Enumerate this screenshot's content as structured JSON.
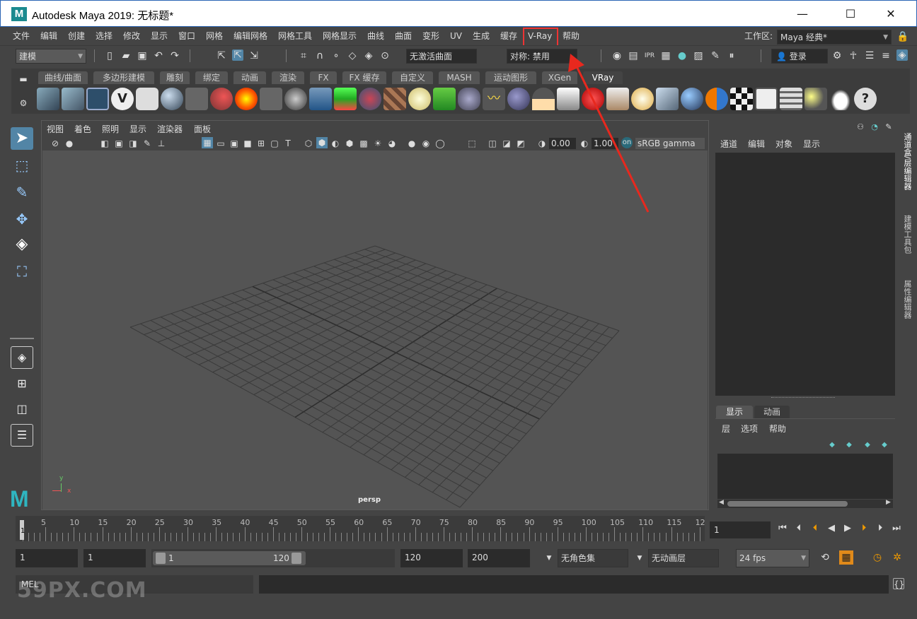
{
  "window": {
    "title": "Autodesk Maya 2019: 无标题*",
    "logo_letter": "M"
  },
  "menu": {
    "items": [
      "文件",
      "编辑",
      "创建",
      "选择",
      "修改",
      "显示",
      "窗口",
      "网格",
      "编辑网格",
      "网格工具",
      "网格显示",
      "曲线",
      "曲面",
      "变形",
      "UV",
      "生成",
      "缓存",
      "V-Ray",
      "帮助"
    ],
    "highlighted": "V-Ray",
    "workspace_label": "工作区:",
    "workspace_value": "Maya 经典*"
  },
  "status_line": {
    "mode": "建模",
    "live_surface": "无激活曲面",
    "symmetry": "对称: 禁用",
    "login": "登录"
  },
  "shelf": {
    "tabs": [
      "曲线/曲面",
      "多边形建模",
      "雕刻",
      "绑定",
      "动画",
      "渲染",
      "FX",
      "FX 缓存",
      "自定义",
      "MASH",
      "运动图形",
      "XGen",
      "VRay"
    ],
    "active_tab": "VRay"
  },
  "viewport": {
    "menu": [
      "视图",
      "着色",
      "照明",
      "显示",
      "渲染器",
      "面板"
    ],
    "exposure": "0.00",
    "gamma": "1.00",
    "color_space": "sRGB gamma",
    "camera_label": "persp",
    "axis_y": "y",
    "axis_x": "x"
  },
  "channel_box": {
    "menu": [
      "通道",
      "编辑",
      "对象",
      "显示"
    ],
    "side_tabs": [
      "通道盒/层编辑器",
      "建模工具包",
      "属性编辑器"
    ]
  },
  "layer_editor": {
    "tabs": [
      "显示",
      "动画"
    ],
    "active_tab": "显示",
    "menu": [
      "层",
      "选项",
      "帮助"
    ]
  },
  "timeline": {
    "ticks": [
      "5",
      "10",
      "15",
      "20",
      "25",
      "30",
      "35",
      "40",
      "45",
      "50",
      "55",
      "60",
      "65",
      "70",
      "75",
      "80",
      "85",
      "90",
      "95",
      "100",
      "105",
      "110",
      "115",
      "12"
    ],
    "start_marker": "1",
    "current_frame": "1"
  },
  "range_slider": {
    "start": "1",
    "playback_start": "1",
    "slider_start": "1",
    "slider_end": "120",
    "playback_end": "120",
    "end": "200",
    "character_set": "无角色集",
    "anim_layer": "无动画层",
    "fps": "24 fps"
  },
  "command_line": {
    "language": "MEL"
  },
  "watermark": "59PX.COM",
  "colors": {
    "highlight_box": "#e33333",
    "maya_teal": "#1b8a8f",
    "active_blue": "#5285a6"
  }
}
